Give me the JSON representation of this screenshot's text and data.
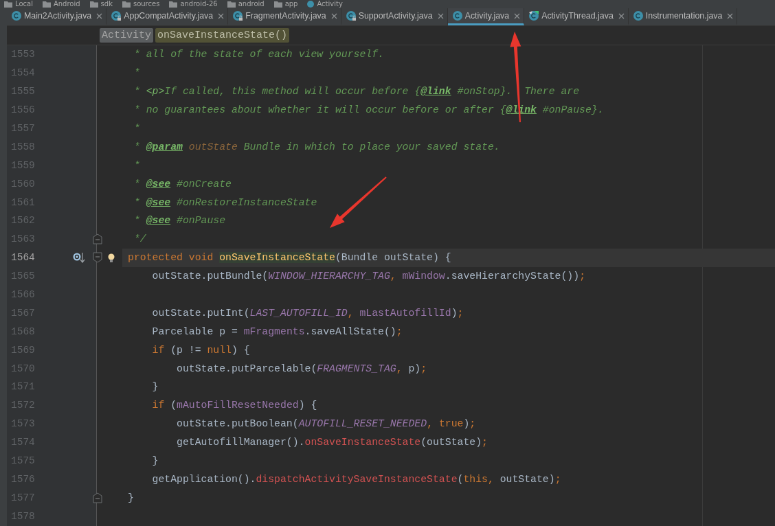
{
  "breadcrumb": [
    {
      "label": "Local",
      "kind": "folder"
    },
    {
      "label": "Android",
      "kind": "folder"
    },
    {
      "label": "sdk",
      "kind": "folder"
    },
    {
      "label": "sources",
      "kind": "folder"
    },
    {
      "label": "android-26",
      "kind": "folder"
    },
    {
      "label": "android",
      "kind": "folder"
    },
    {
      "label": "app",
      "kind": "folder"
    },
    {
      "label": "Activity",
      "kind": "class"
    }
  ],
  "tabs": [
    {
      "label": "Main2Activity.java",
      "kind": "class",
      "selected": false
    },
    {
      "label": "AppCompatActivity.java",
      "kind": "locked",
      "selected": false
    },
    {
      "label": "FragmentActivity.java",
      "kind": "locked",
      "selected": false
    },
    {
      "label": "SupportActivity.java",
      "kind": "locked",
      "selected": false
    },
    {
      "label": "Activity.java",
      "kind": "class",
      "selected": true
    },
    {
      "label": "ActivityThread.java",
      "kind": "runnable",
      "selected": false
    },
    {
      "label": "Instrumentation.java",
      "kind": "class",
      "selected": false
    }
  ],
  "navigation": [
    {
      "label": "Activity",
      "kind": "class"
    },
    {
      "label": "onSaveInstanceState()",
      "kind": "method"
    }
  ],
  "lines": [
    {
      "number": "1553",
      "current": false,
      "tokens": [
        {
          "text": " * all of the state of each view yourself.",
          "kind": "comment"
        }
      ]
    },
    {
      "number": "1554",
      "current": false,
      "tokens": [
        {
          "text": " *",
          "kind": "comment"
        }
      ]
    },
    {
      "number": "1555",
      "current": false,
      "tokens": [
        {
          "text": " * ",
          "kind": "comment"
        },
        {
          "text": "<p>",
          "kind": "doc-markup"
        },
        {
          "text": "If called, this method will occur before {",
          "kind": "comment"
        },
        {
          "text": "@link",
          "kind": "doc-tag"
        },
        {
          "text": " #onStop}.  There are",
          "kind": "comment"
        }
      ]
    },
    {
      "number": "1556",
      "current": false,
      "tokens": [
        {
          "text": " * no guarantees about whether it will occur before or after {",
          "kind": "comment"
        },
        {
          "text": "@link",
          "kind": "doc-tag"
        },
        {
          "text": " #onPause}.",
          "kind": "comment"
        }
      ]
    },
    {
      "number": "1557",
      "current": false,
      "tokens": [
        {
          "text": " *",
          "kind": "comment"
        }
      ]
    },
    {
      "number": "1558",
      "current": false,
      "tokens": [
        {
          "text": " * ",
          "kind": "comment"
        },
        {
          "text": "@param",
          "kind": "doc-tag"
        },
        {
          "text": " outState",
          "kind": "doc-param"
        },
        {
          "text": " Bundle in which to place your saved state.",
          "kind": "comment"
        }
      ]
    },
    {
      "number": "1559",
      "current": false,
      "tokens": [
        {
          "text": " *",
          "kind": "comment"
        }
      ]
    },
    {
      "number": "1560",
      "current": false,
      "tokens": [
        {
          "text": " * ",
          "kind": "comment"
        },
        {
          "text": "@see",
          "kind": "doc-tag"
        },
        {
          "text": " #onCreate",
          "kind": "comment"
        }
      ]
    },
    {
      "number": "1561",
      "current": false,
      "tokens": [
        {
          "text": " * ",
          "kind": "comment"
        },
        {
          "text": "@see",
          "kind": "doc-tag"
        },
        {
          "text": " #onRestoreInstanceState",
          "kind": "comment"
        }
      ]
    },
    {
      "number": "1562",
      "current": false,
      "tokens": [
        {
          "text": " * ",
          "kind": "comment"
        },
        {
          "text": "@see",
          "kind": "doc-tag"
        },
        {
          "text": " #onPause",
          "kind": "comment"
        }
      ]
    },
    {
      "number": "1563",
      "current": false,
      "markers": [
        {
          "kind": "fold-end"
        }
      ],
      "tokens": [
        {
          "text": " */",
          "kind": "comment"
        }
      ]
    },
    {
      "number": "1564",
      "current": true,
      "markers": [
        {
          "kind": "override"
        },
        {
          "kind": "fold-start"
        },
        {
          "kind": "bulb"
        }
      ],
      "tokens": [
        {
          "text": "protected void ",
          "kind": "keyword"
        },
        {
          "text": "onSaveInstanceState",
          "kind": "decl"
        },
        {
          "text": "(Bundle outState) {",
          "kind": "plain"
        }
      ]
    },
    {
      "number": "1565",
      "current": false,
      "tokens": [
        {
          "text": "    outState.putBundle(",
          "kind": "plain"
        },
        {
          "text": "WINDOW_HIERARCHY_TAG",
          "kind": "constant"
        },
        {
          "text": ", ",
          "kind": "punct"
        },
        {
          "text": "mWindow",
          "kind": "field"
        },
        {
          "text": ".saveHierarchyState())",
          "kind": "plain"
        },
        {
          "text": ";",
          "kind": "punct"
        }
      ]
    },
    {
      "number": "1566",
      "current": false
    },
    {
      "number": "1567",
      "current": false,
      "tokens": [
        {
          "text": "    outState.putInt(",
          "kind": "plain"
        },
        {
          "text": "LAST_AUTOFILL_ID",
          "kind": "constant"
        },
        {
          "text": ", ",
          "kind": "punct"
        },
        {
          "text": "mLastAutofillId",
          "kind": "field"
        },
        {
          "text": ")",
          "kind": "plain"
        },
        {
          "text": ";",
          "kind": "punct"
        }
      ]
    },
    {
      "number": "1568",
      "current": false,
      "tokens": [
        {
          "text": "    Parcelable p = ",
          "kind": "plain"
        },
        {
          "text": "mFragments",
          "kind": "field"
        },
        {
          "text": ".saveAllState()",
          "kind": "plain"
        },
        {
          "text": ";",
          "kind": "punct"
        }
      ]
    },
    {
      "number": "1569",
      "current": false,
      "tokens": [
        {
          "text": "    if",
          "kind": "keyword"
        },
        {
          "text": " (p != ",
          "kind": "plain"
        },
        {
          "text": "null",
          "kind": "keyword"
        },
        {
          "text": ") {",
          "kind": "plain"
        }
      ]
    },
    {
      "number": "1570",
      "current": false,
      "tokens": [
        {
          "text": "        outState.putParcelable(",
          "kind": "plain"
        },
        {
          "text": "FRAGMENTS_TAG",
          "kind": "constant"
        },
        {
          "text": ", ",
          "kind": "punct"
        },
        {
          "text": "p)",
          "kind": "plain"
        },
        {
          "text": ";",
          "kind": "punct"
        }
      ]
    },
    {
      "number": "1571",
      "current": false,
      "tokens": [
        {
          "text": "    }",
          "kind": "plain"
        }
      ]
    },
    {
      "number": "1572",
      "current": false,
      "tokens": [
        {
          "text": "    if",
          "kind": "keyword"
        },
        {
          "text": " (",
          "kind": "plain"
        },
        {
          "text": "mAutoFillResetNeeded",
          "kind": "field"
        },
        {
          "text": ") {",
          "kind": "plain"
        }
      ]
    },
    {
      "number": "1573",
      "current": false,
      "tokens": [
        {
          "text": "        outState.putBoolean(",
          "kind": "plain"
        },
        {
          "text": "AUTOFILL_RESET_NEEDED",
          "kind": "constant"
        },
        {
          "text": ", ",
          "kind": "punct"
        },
        {
          "text": "true",
          "kind": "keyword"
        },
        {
          "text": ")",
          "kind": "plain"
        },
        {
          "text": ";",
          "kind": "punct"
        }
      ]
    },
    {
      "number": "1574",
      "current": false,
      "tokens": [
        {
          "text": "        getAutofillManager().",
          "kind": "plain"
        },
        {
          "text": "onSaveInstanceState",
          "kind": "error"
        },
        {
          "text": "(outState)",
          "kind": "plain"
        },
        {
          "text": ";",
          "kind": "punct"
        }
      ]
    },
    {
      "number": "1575",
      "current": false,
      "tokens": [
        {
          "text": "    }",
          "kind": "plain"
        }
      ]
    },
    {
      "number": "1576",
      "current": false,
      "tokens": [
        {
          "text": "    getApplication().",
          "kind": "plain"
        },
        {
          "text": "dispatchActivitySaveInstanceState",
          "kind": "error"
        },
        {
          "text": "(",
          "kind": "plain"
        },
        {
          "text": "this",
          "kind": "keyword"
        },
        {
          "text": ", ",
          "kind": "punct"
        },
        {
          "text": "outState)",
          "kind": "plain"
        },
        {
          "text": ";",
          "kind": "punct"
        }
      ]
    },
    {
      "number": "1577",
      "current": false,
      "markers": [
        {
          "kind": "fold-end"
        }
      ],
      "tokens": [
        {
          "text": "}",
          "kind": "plain"
        }
      ]
    },
    {
      "number": "1578",
      "current": false
    }
  ],
  "annotations": [
    {
      "kind": "arrow"
    },
    {
      "kind": "arrow"
    }
  ]
}
